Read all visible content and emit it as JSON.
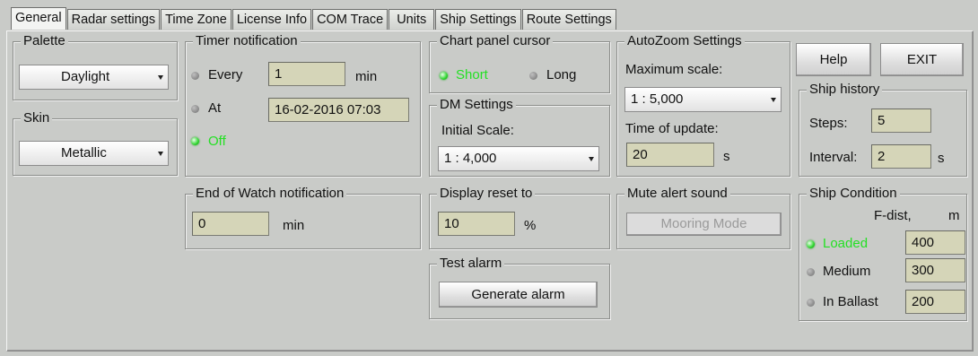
{
  "tabs": [
    "General",
    "Radar settings",
    "Time Zone",
    "License Info",
    "COM Trace",
    "Units",
    "Ship Settings",
    "Route Settings"
  ],
  "palette": {
    "legend": "Palette",
    "value": "Daylight"
  },
  "skin": {
    "legend": "Skin",
    "value": "Metallic"
  },
  "timer": {
    "legend": "Timer notification",
    "every_label": "Every",
    "every_value": "1",
    "every_unit": "min",
    "at_label": "At",
    "at_value": "16-02-2016 07:03",
    "off_label": "Off"
  },
  "cursor": {
    "legend": "Chart panel cursor",
    "short_label": "Short",
    "long_label": "Long"
  },
  "dm": {
    "legend": "DM Settings",
    "initial_label": "Initial Scale:",
    "initial_value": "1 : 4,000"
  },
  "autozoom": {
    "legend": "AutoZoom Settings",
    "max_label": "Maximum scale:",
    "max_value": "1 : 5,000",
    "update_label": "Time of update:",
    "update_value": "20",
    "update_unit": "s"
  },
  "buttons": {
    "help": "Help",
    "exit": "EXIT"
  },
  "history": {
    "legend": "Ship history",
    "steps_label": "Steps:",
    "steps_value": "5",
    "interval_label": "Interval:",
    "interval_value": "2",
    "interval_unit": "s"
  },
  "watch": {
    "legend": "End of Watch notification",
    "value": "0",
    "unit": "min"
  },
  "reset": {
    "legend": "Display reset to",
    "value": "10",
    "unit": "%"
  },
  "mute": {
    "legend": "Mute alert sound",
    "mooring": "Mooring Mode"
  },
  "alarm": {
    "legend": "Test alarm",
    "button": "Generate alarm"
  },
  "condition": {
    "legend": "Ship Condition",
    "fdist_label": "F-dist,",
    "unit": "m",
    "rows": [
      {
        "label": "Loaded",
        "value": "400"
      },
      {
        "label": "Medium",
        "value": "300"
      },
      {
        "label": "In Ballast",
        "value": "200"
      }
    ]
  },
  "colors": {
    "active_radio": "#24e024",
    "field_bg": "#d5d5b8",
    "panel_bg": "#c9cbc8"
  }
}
